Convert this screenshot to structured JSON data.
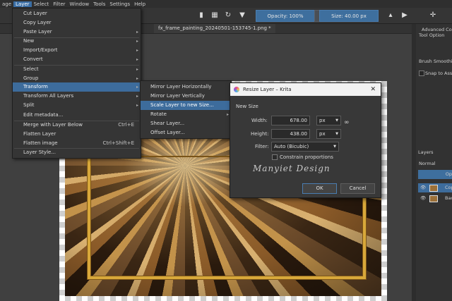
{
  "menubar": {
    "items": [
      "age",
      "Layer",
      "Select",
      "Filter",
      "Window",
      "Tools",
      "Settings",
      "Help"
    ]
  },
  "toolbar": {
    "opacity_label": "Opacity: 100%",
    "size_label": "Size: 40.00 px"
  },
  "document": {
    "tab_title": "fx_frame_painting_20240501-153745-1.png *"
  },
  "right_panel": {
    "advanced_color": "Advanced Colo",
    "tool_options": "Tool Option",
    "brush_smoothing": "Brush Smoothin",
    "snap_to_assistant": "Snap to Assi",
    "layers_title": "Layers",
    "blend_mode": "Normal",
    "opacity_short": "Op",
    "layer1": "Cop",
    "layer2": "Back"
  },
  "layer_menu": {
    "items": [
      {
        "label": "Cut Layer",
        "shortcut": "",
        "arrow": false
      },
      {
        "label": "Copy Layer",
        "shortcut": "",
        "arrow": false
      },
      {
        "label": "Paste Layer",
        "shortcut": "",
        "arrow": true
      },
      {
        "label": "New",
        "shortcut": "",
        "arrow": true
      },
      {
        "label": "Import/Export",
        "shortcut": "",
        "arrow": true
      },
      {
        "label": "Convert",
        "shortcut": "",
        "arrow": true
      },
      {
        "label": "Select",
        "shortcut": "",
        "arrow": true
      },
      {
        "label": "Group",
        "shortcut": "",
        "arrow": true
      },
      {
        "label": "Transform",
        "shortcut": "",
        "arrow": true
      },
      {
        "label": "Transform All Layers",
        "shortcut": "",
        "arrow": true
      },
      {
        "label": "Split",
        "shortcut": "",
        "arrow": true
      },
      {
        "label": "Edit metadata...",
        "shortcut": "",
        "arrow": false
      },
      {
        "label": "Merge with Layer Below",
        "shortcut": "Ctrl+E",
        "arrow": false
      },
      {
        "label": "Flatten Layer",
        "shortcut": "",
        "arrow": false
      },
      {
        "label": "Flatten image",
        "shortcut": "Ctrl+Shift+E",
        "arrow": false
      },
      {
        "label": "Layer Style...",
        "shortcut": "",
        "arrow": false
      }
    ]
  },
  "transform_submenu": {
    "items": [
      {
        "label": "Mirror Layer Horizontally"
      },
      {
        "label": "Mirror Layer Vertically"
      },
      {
        "label": "Scale Layer to new Size..."
      },
      {
        "label": "Rotate"
      },
      {
        "label": "Shear Layer..."
      },
      {
        "label": "Offset Layer..."
      }
    ]
  },
  "dialog": {
    "title": "Resize Layer – Krita",
    "section": "New Size",
    "width_label": "Width:",
    "width_value": "678.00",
    "width_unit": "px",
    "height_label": "Height:",
    "height_value": "438.00",
    "height_unit": "px",
    "filter_label": "Filter:",
    "filter_value": "Auto (Bicubic)",
    "constrain_label": "Constrain proportions",
    "constrain_checked": false,
    "ok": "OK",
    "cancel": "Cancel"
  },
  "watermark": {
    "text": "Manyiet Design"
  },
  "colors": {
    "menu_highlight": "#3d6c9c",
    "toolbar_blue": "#3e6f9e",
    "gold": "#d8a83a"
  }
}
